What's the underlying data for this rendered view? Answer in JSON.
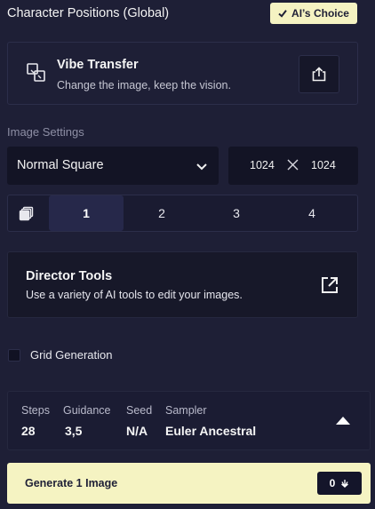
{
  "header": {
    "title": "Character Positions (Global)",
    "badge_label": "AI’s Choice"
  },
  "vibe_transfer": {
    "title": "Vibe Transfer",
    "subtitle": "Change the image, keep the vision."
  },
  "image_settings": {
    "label": "Image Settings",
    "resolution": "Normal Square",
    "width": "1024",
    "height": "1024",
    "count_options": [
      "1",
      "2",
      "3",
      "4"
    ],
    "selected_count": "1"
  },
  "director_tools": {
    "title": "Director Tools",
    "subtitle": "Use a variety of AI tools to edit your images."
  },
  "grid_generation": {
    "label": "Grid Generation",
    "checked": false
  },
  "summary": {
    "steps_label": "Steps",
    "steps_value": "28",
    "guidance_label": "Guidance",
    "guidance_value": "3,5",
    "seed_label": "Seed",
    "seed_value": "N/A",
    "sampler_label": "Sampler",
    "sampler_value": "Euler Ancestral"
  },
  "generate": {
    "label": "Generate 1 Image",
    "cost": "0"
  },
  "colors": {
    "background": "#1e1f36",
    "accent": "#f5f3c2",
    "input_bg": "#131425"
  }
}
